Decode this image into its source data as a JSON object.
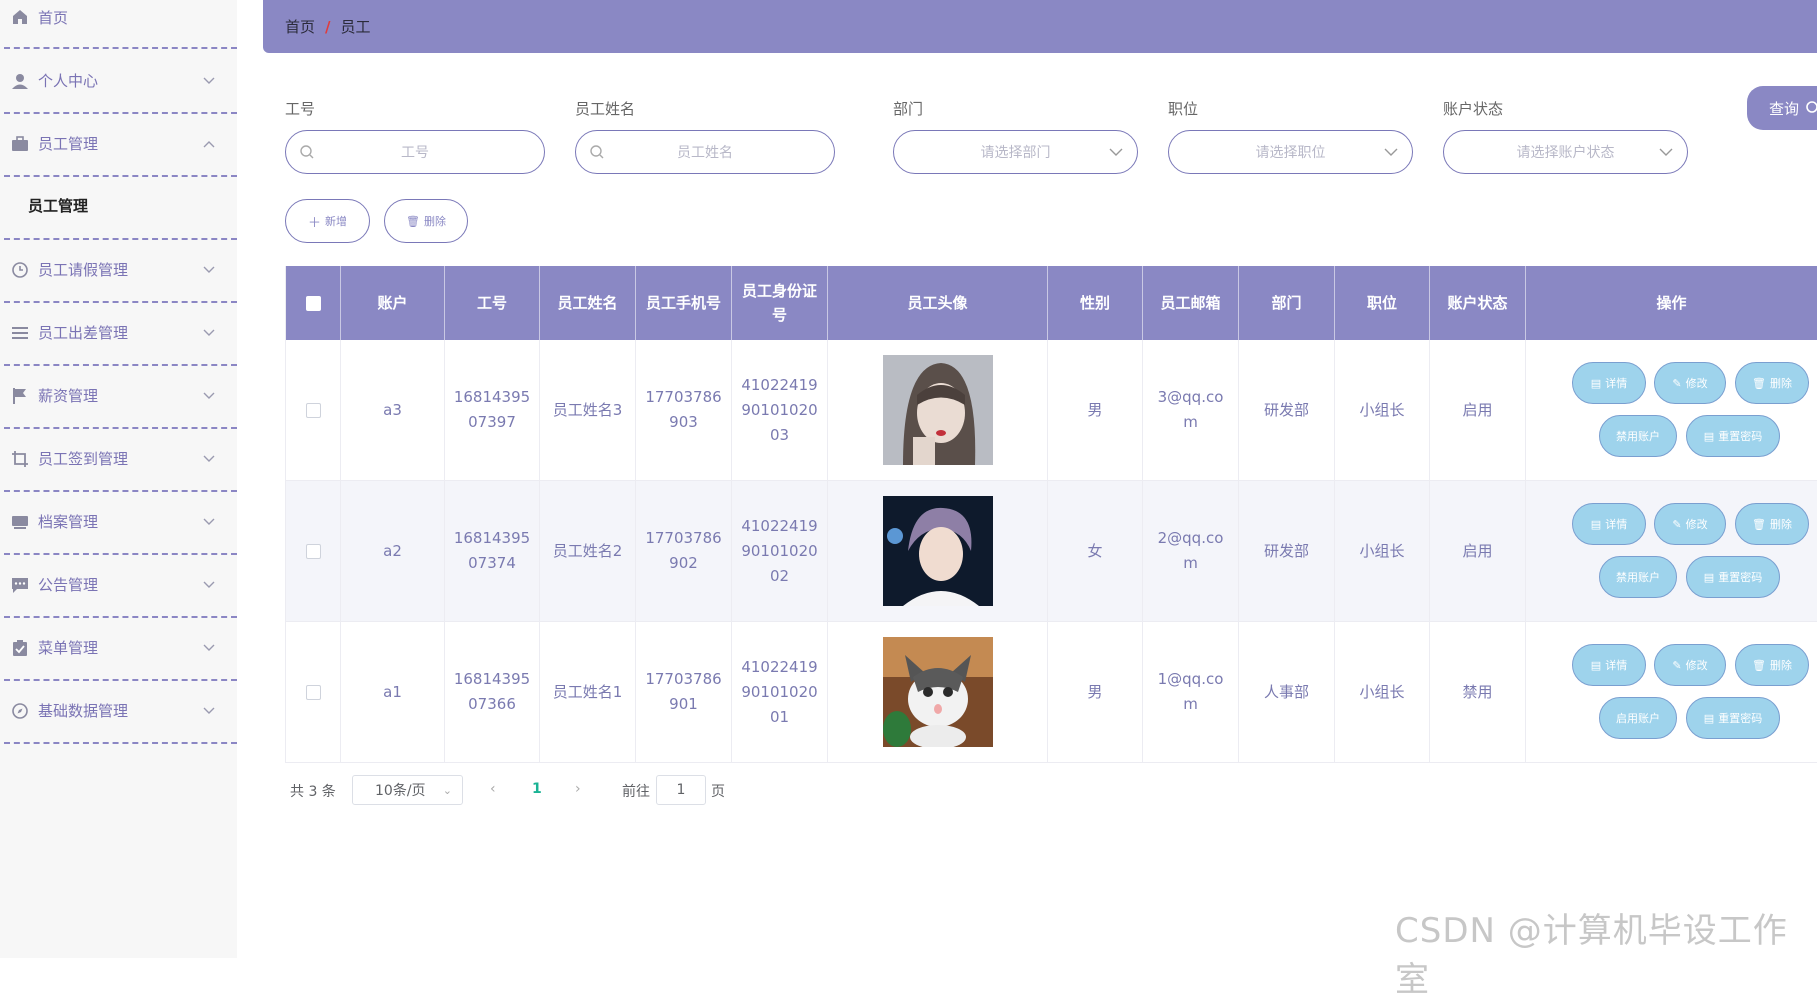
{
  "sidebar": {
    "items": [
      {
        "label": "首页",
        "icon": "home-icon",
        "chevron": false
      },
      {
        "label": "个人中心",
        "icon": "user-icon",
        "chevron": true
      },
      {
        "label": "员工管理",
        "icon": "briefcase-icon",
        "chevron": true,
        "expanded": true,
        "children": [
          {
            "label": "员工管理"
          }
        ]
      },
      {
        "label": "员工请假管理",
        "icon": "clock-icon",
        "chevron": true
      },
      {
        "label": "员工出差管理",
        "icon": "list-icon",
        "chevron": true
      },
      {
        "label": "薪资管理",
        "icon": "flag-icon",
        "chevron": true
      },
      {
        "label": "员工签到管理",
        "icon": "crop-icon",
        "chevron": true
      },
      {
        "label": "档案管理",
        "icon": "archive-icon",
        "chevron": true
      },
      {
        "label": "公告管理",
        "icon": "chat-icon",
        "chevron": true
      },
      {
        "label": "菜单管理",
        "icon": "clipboard-icon",
        "chevron": true
      },
      {
        "label": "基础数据管理",
        "icon": "compass-icon",
        "chevron": true
      }
    ]
  },
  "breadcrumb": {
    "home": "首页",
    "separator": "/",
    "current": "员工"
  },
  "search": {
    "fields": [
      {
        "label": "工号",
        "placeholder": "工号",
        "type": "input"
      },
      {
        "label": "员工姓名",
        "placeholder": "员工姓名",
        "type": "input"
      },
      {
        "label": "部门",
        "placeholder": "请选择部门",
        "type": "select"
      },
      {
        "label": "职位",
        "placeholder": "请选择职位",
        "type": "select"
      },
      {
        "label": "账户状态",
        "placeholder": "请选择账户状态",
        "type": "select"
      }
    ],
    "query_label": "查询"
  },
  "actions": {
    "add_label": "新增",
    "delete_label": "删除"
  },
  "table": {
    "headers": [
      "账户",
      "工号",
      "员工姓名",
      "员工手机号",
      "员工身份证号",
      "员工头像",
      "性别",
      "员工邮箱",
      "部门",
      "职位",
      "账户状态",
      "操作"
    ],
    "rows": [
      {
        "account": "a3",
        "emp_no": "1681439507397",
        "name": "员工姓名3",
        "phone": "17703786903",
        "id_card": "410224199010102003",
        "avatar": "girl-portrait",
        "gender": "男",
        "email": "3@qq.com",
        "dept": "研发部",
        "position": "小组长",
        "status": "启用",
        "toggle_label": "禁用账户"
      },
      {
        "account": "a2",
        "emp_no": "1681439507374",
        "name": "员工姓名2",
        "phone": "17703786902",
        "id_card": "410224199010102002",
        "avatar": "boy-portrait",
        "gender": "女",
        "email": "2@qq.com",
        "dept": "研发部",
        "position": "小组长",
        "status": "启用",
        "toggle_label": "禁用账户"
      },
      {
        "account": "a1",
        "emp_no": "1681439507366",
        "name": "员工姓名1",
        "phone": "17703786901",
        "id_card": "410224199010102001",
        "avatar": "cat-photo",
        "gender": "男",
        "email": "1@qq.com",
        "dept": "人事部",
        "position": "小组长",
        "status": "禁用",
        "toggle_label": "启用账户"
      }
    ],
    "op_labels": {
      "detail": "详情",
      "edit": "修改",
      "delete": "删除",
      "reset": "重置密码"
    }
  },
  "pagination": {
    "total_text": "共 3 条",
    "page_size": "10条/页",
    "current_page": "1",
    "goto_prefix": "前往",
    "goto_value": "1",
    "goto_suffix": "页"
  },
  "watermark": "CSDN @计算机毕设工作室",
  "colors": {
    "primary": "#8a88c4",
    "op_button": "#9ed3ec",
    "menu_text": "#7a73b4"
  }
}
